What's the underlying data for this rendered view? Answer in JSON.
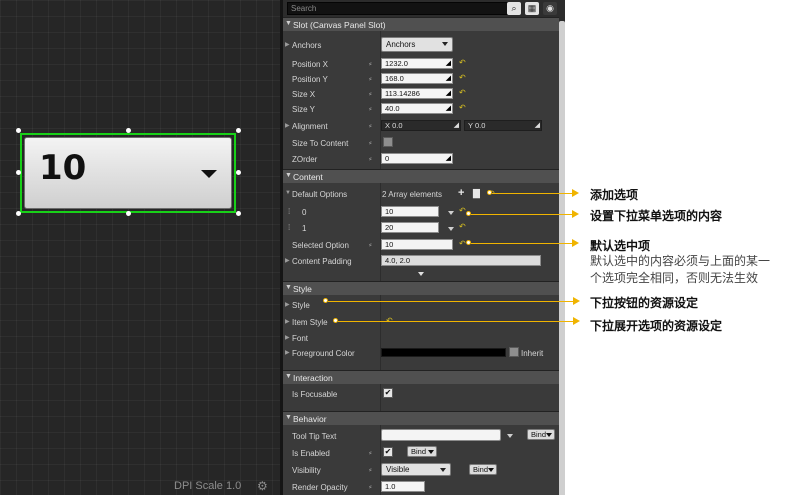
{
  "canvas": {
    "combobox_value": "10",
    "dpi_label": "DPI Scale 1.0",
    "dpi_icon": "gear-icon"
  },
  "details": {
    "search_placeholder": "Search",
    "toolbar_icons": [
      "search-icon",
      "grid-view-icon",
      "eye-icon"
    ],
    "slot": {
      "title": "Slot (Canvas Panel Slot)",
      "anchors_label": "Anchors",
      "anchors_value": "Anchors",
      "position_x_label": "Position X",
      "position_x": "1232.0",
      "position_y_label": "Position Y",
      "position_y": "168.0",
      "size_x_label": "Size X",
      "size_x": "113.14286",
      "size_y_label": "Size Y",
      "size_y": "40.0",
      "alignment_label": "Alignment",
      "alignment_x": "X  0.0",
      "alignment_y": "Y  0.0",
      "size_to_content_label": "Size To Content",
      "zorder_label": "ZOrder",
      "zorder": "0"
    },
    "content": {
      "title": "Content",
      "default_options_label": "Default Options",
      "array_summary": "2 Array elements",
      "items": [
        {
          "index": "0",
          "value": "10"
        },
        {
          "index": "1",
          "value": "20"
        }
      ],
      "selected_option_label": "Selected Option",
      "selected_option": "10",
      "content_padding_label": "Content Padding",
      "content_padding": "4.0, 2.0"
    },
    "style": {
      "title": "Style",
      "style_label": "Style",
      "item_style_label": "Item Style",
      "font_label": "Font",
      "foreground_label": "Foreground Color",
      "foreground_color": "#000000",
      "inherit_label": "Inherit"
    },
    "interaction": {
      "title": "Interaction",
      "is_focusable_label": "Is Focusable"
    },
    "behavior": {
      "title": "Behavior",
      "tooltip_label": "Tool Tip Text",
      "bind_label": "Bind",
      "is_enabled_label": "Is Enabled",
      "visibility_label": "Visibility",
      "visibility_value": "Visible",
      "render_opacity_label": "Render Opacity",
      "render_opacity": "1.0"
    }
  },
  "annotations": {
    "add_option": "添加选项",
    "option_content": "设置下拉菜单选项的内容",
    "default_selected": "默认选中项",
    "default_note_1": "默认选中的内容必须与上面的某一",
    "default_note_2": "个选项完全相同，否则无法生效",
    "button_style": "下拉按钮的资源设定",
    "item_style": "下拉展开选项的资源设定"
  },
  "colors": {
    "selection_outline": "#18d018",
    "annotation_line": "#f0b400",
    "reset_arrow": "#d8c022"
  }
}
